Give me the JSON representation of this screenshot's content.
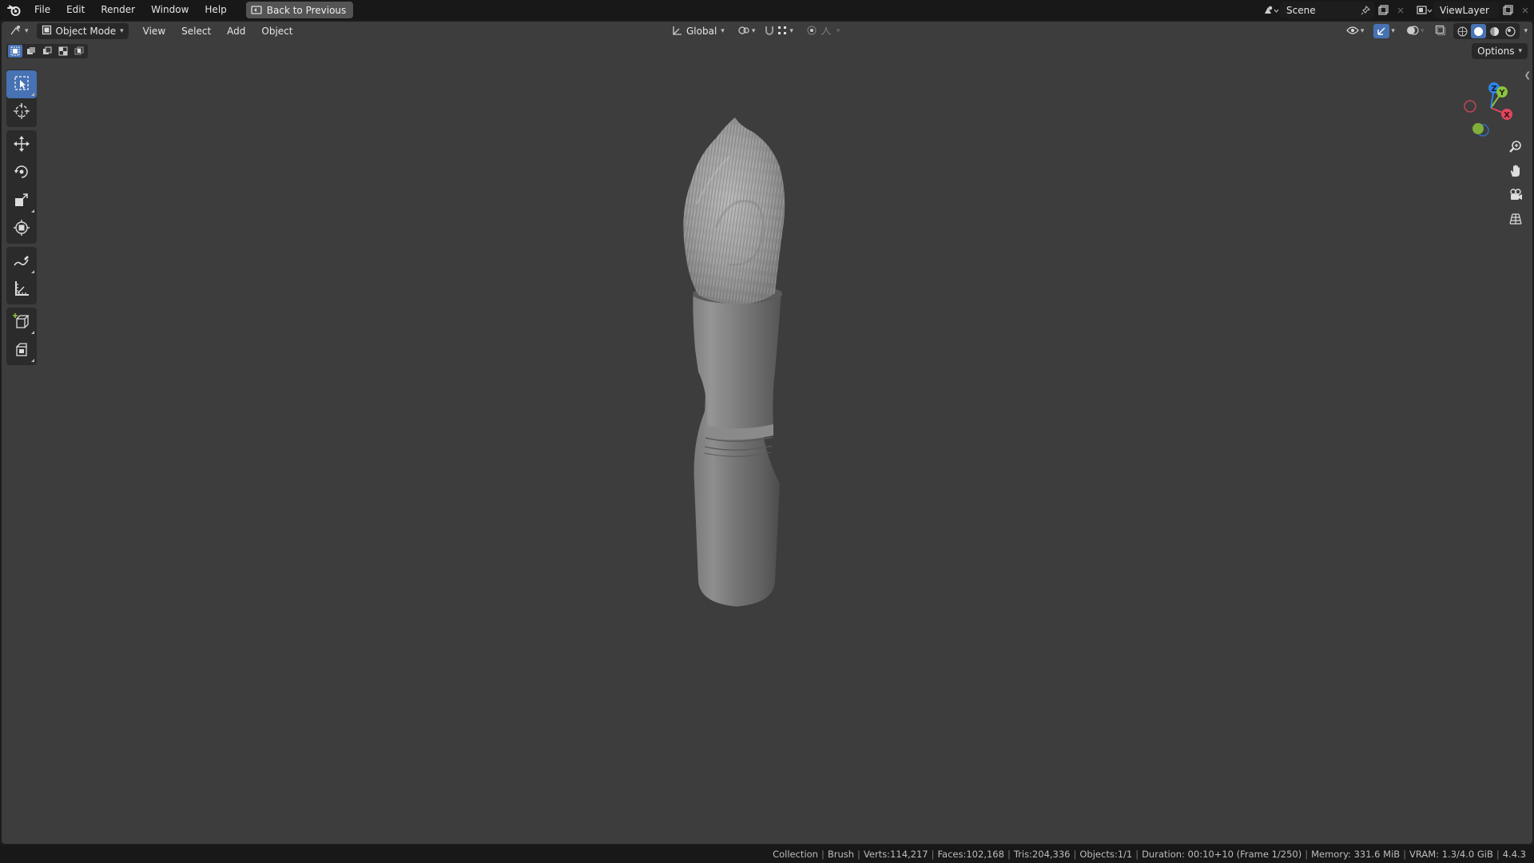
{
  "menubar": {
    "logo_icon": "blender-logo-icon",
    "items": [
      "File",
      "Edit",
      "Render",
      "Window",
      "Help"
    ],
    "back_button": "Back to Previous",
    "scene_name": "Scene",
    "view_layer_name": "ViewLayer"
  },
  "viewport_header": {
    "editor_type_icon": "view3d-icon",
    "mode": "Object Mode",
    "menus": [
      "View",
      "Select",
      "Add",
      "Object"
    ],
    "orientation": "Global",
    "options_label": "Options"
  },
  "toolbar": {
    "tools": [
      {
        "name": "select-box",
        "icon": "select-box-icon",
        "active": true
      },
      {
        "name": "cursor",
        "icon": "cursor-icon"
      },
      {
        "name": "move",
        "icon": "move-icon"
      },
      {
        "name": "rotate",
        "icon": "rotate-icon"
      },
      {
        "name": "scale",
        "icon": "scale-icon"
      },
      {
        "name": "transform",
        "icon": "transform-icon"
      },
      {
        "name": "annotate",
        "icon": "annotate-icon"
      },
      {
        "name": "measure",
        "icon": "measure-icon"
      },
      {
        "name": "add-cube",
        "icon": "add-cube-icon"
      },
      {
        "name": "add-object",
        "icon": "add-object-icon"
      }
    ]
  },
  "gizmo": {
    "x_label": "X",
    "y_label": "Y",
    "z_label": "Z",
    "x_color": "#e0475c",
    "y_color": "#8bc43f",
    "z_color": "#2f83e6"
  },
  "nav_icons": [
    "zoom-icon",
    "pan-hand-icon",
    "camera-icon",
    "ortho-grid-icon"
  ],
  "statusbar": {
    "items": [
      "Collection",
      "Brush",
      "Verts:114,217",
      "Faces:102,168",
      "Tris:204,336",
      "Objects:1/1",
      "Duration: 00:10+10 (Frame 1/250)",
      "Memory: 331.6 MiB",
      "VRAM: 1.3/4.0 GiB",
      "4.4.3"
    ]
  },
  "colors": {
    "viewport_bg": "#3d3d3d",
    "accent": "#4772b3",
    "topbar_bg": "#181818"
  }
}
